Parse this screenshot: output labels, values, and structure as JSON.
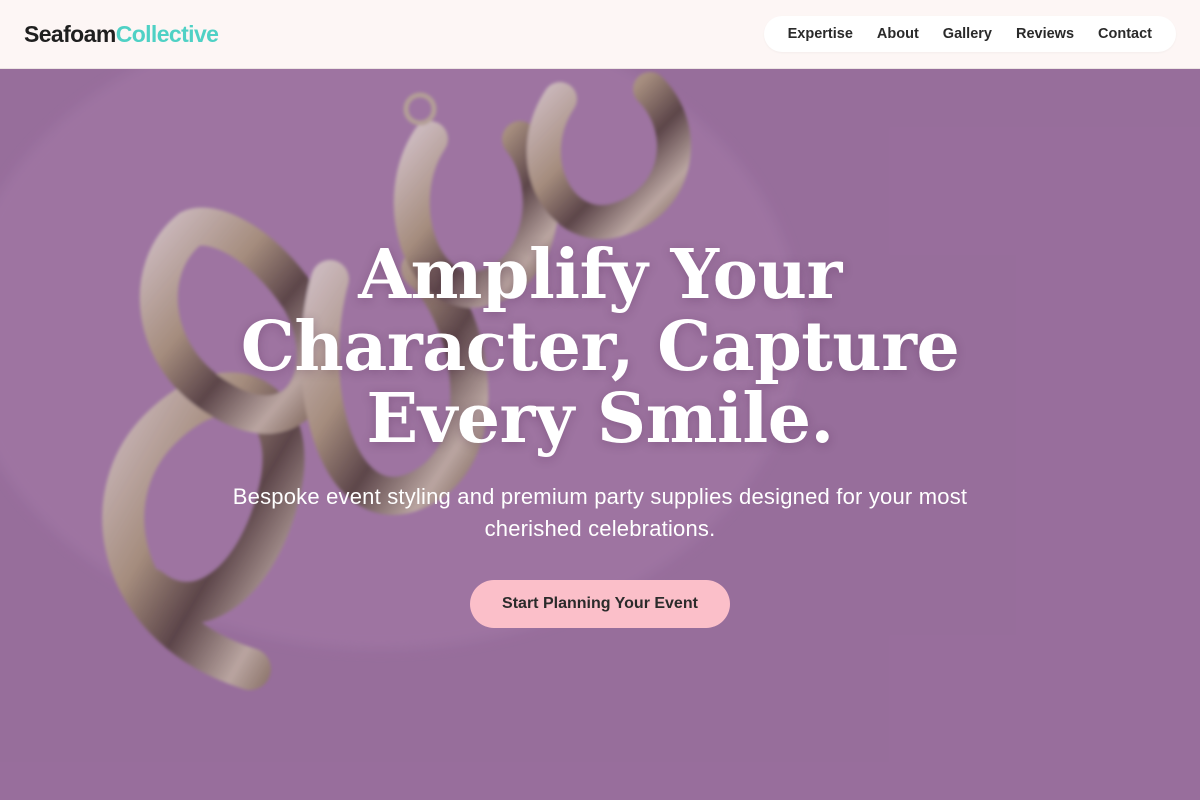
{
  "header": {
    "logo_primary": "Seafoam",
    "logo_accent": "Collective",
    "nav": [
      {
        "label": "Expertise"
      },
      {
        "label": "About"
      },
      {
        "label": "Gallery"
      },
      {
        "label": "Reviews"
      },
      {
        "label": "Contact"
      }
    ]
  },
  "hero": {
    "title": "Amplify Your Character, Capture Every Smile.",
    "subtitle": "Bespoke event styling and premium party supplies designed for your most cherished celebrations.",
    "cta_label": "Start Planning Your Event",
    "background_image": "gold-balloon-script-on-pink-background"
  },
  "colors": {
    "brand_accent": "#4fd1c5",
    "cta_background": "#fbbfc9",
    "header_background": "#fdf6f5",
    "hero_tint": "#9a6d9e"
  }
}
